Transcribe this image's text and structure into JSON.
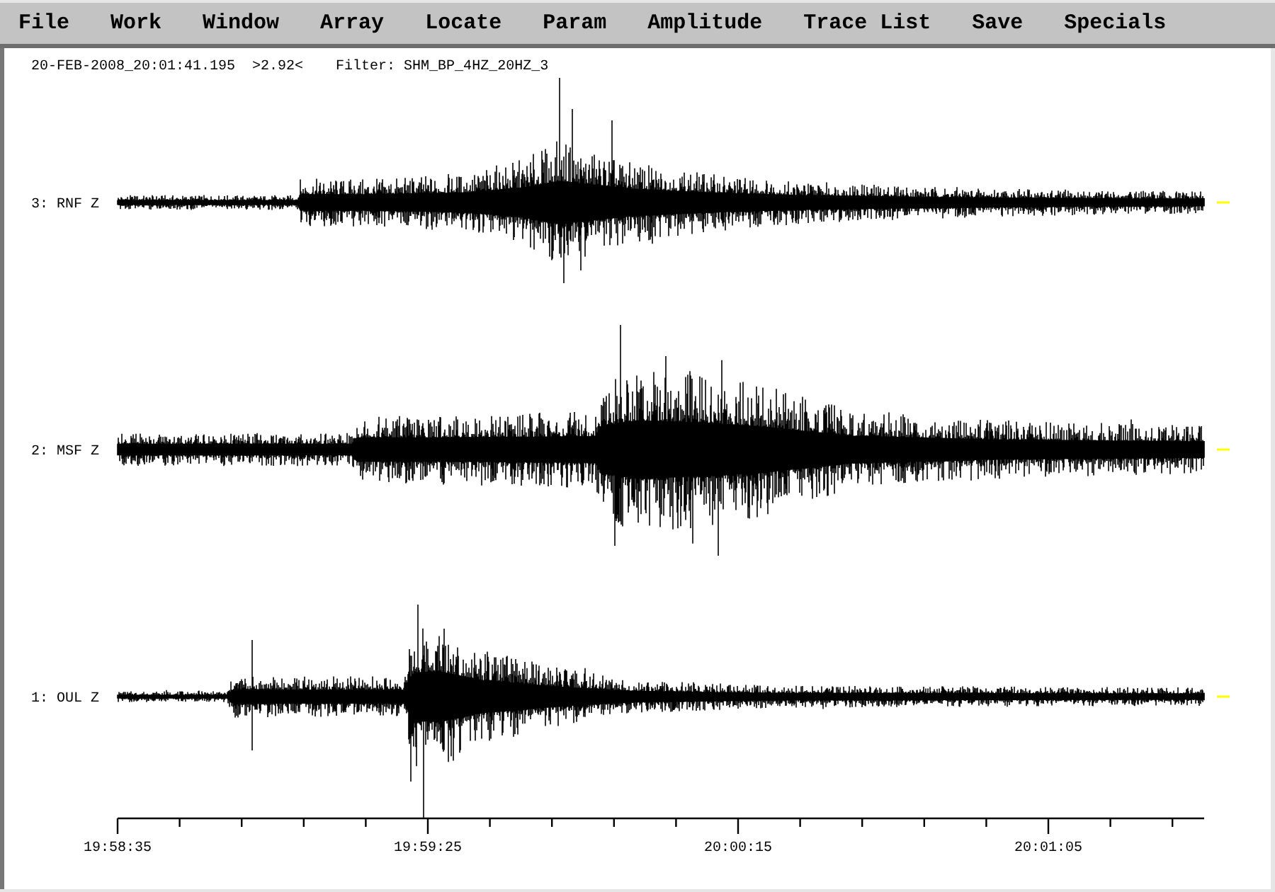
{
  "menu_bar": [
    "File",
    "Work",
    "Window",
    "Array",
    "Locate",
    "Param",
    "Amplitude",
    "Trace List",
    "Save",
    "Specials"
  ],
  "header": {
    "timestamp": "20-FEB-2008_20:01:41.195",
    "scale": ">2.92<",
    "filter": "Filter: SHM_BP_4HZ_20HZ_3"
  },
  "traces": [
    {
      "label": "3: RNF Z"
    },
    {
      "label": "2: MSF Z"
    },
    {
      "label": "1: OUL Z"
    }
  ],
  "time_axis": {
    "labels": [
      "19:58:35",
      "19:59:25",
      "20:00:15",
      "20:01:05"
    ]
  }
}
